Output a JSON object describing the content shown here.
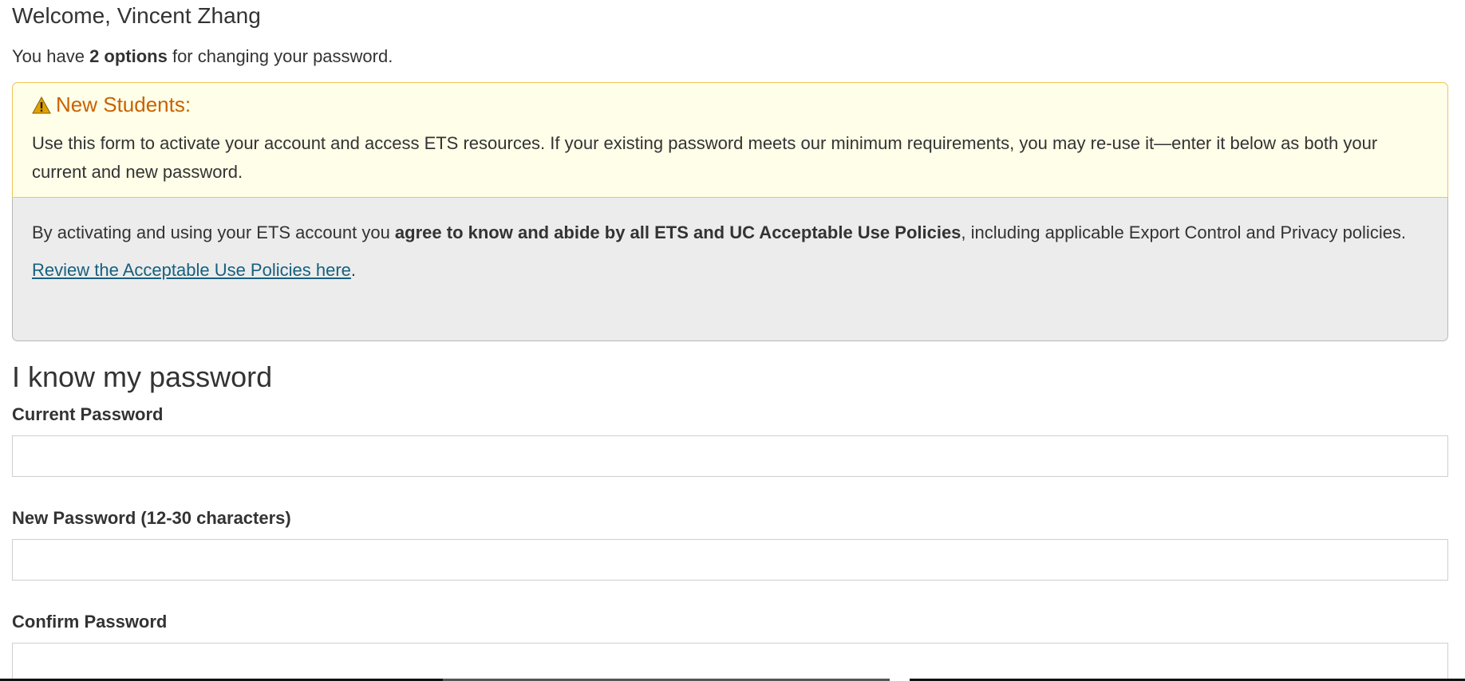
{
  "welcome": "Welcome, Vincent Zhang",
  "intro": {
    "prefix": "You have ",
    "bold": "2 options",
    "suffix": " for changing your password."
  },
  "new_students_alert": {
    "icon": "warning-icon",
    "heading": "New Students:",
    "body": "Use this form to activate your account and access ETS resources. If your existing password meets our minimum requirements, you may re-use it—enter it below as both your current and new password.",
    "heading_color": "#c96200",
    "background": "#fffee8"
  },
  "policy_notice": {
    "prefix": "By activating and using your ETS account you ",
    "bold": "agree to know and abide by all ETS and UC Acceptable Use Policies",
    "suffix": ", including applicable Export Control and Privacy policies.",
    "link_text": "Review the Acceptable Use Policies here",
    "link_suffix": ".",
    "link_color": "#16607f",
    "background": "#ececec"
  },
  "form": {
    "section_title": "I know my password",
    "fields": [
      {
        "label": "Current Password",
        "value": "",
        "placeholder": ""
      },
      {
        "label": "New Password (12-30 characters)",
        "value": "",
        "placeholder": ""
      },
      {
        "label": "Confirm Password",
        "value": "",
        "placeholder": ""
      }
    ]
  }
}
